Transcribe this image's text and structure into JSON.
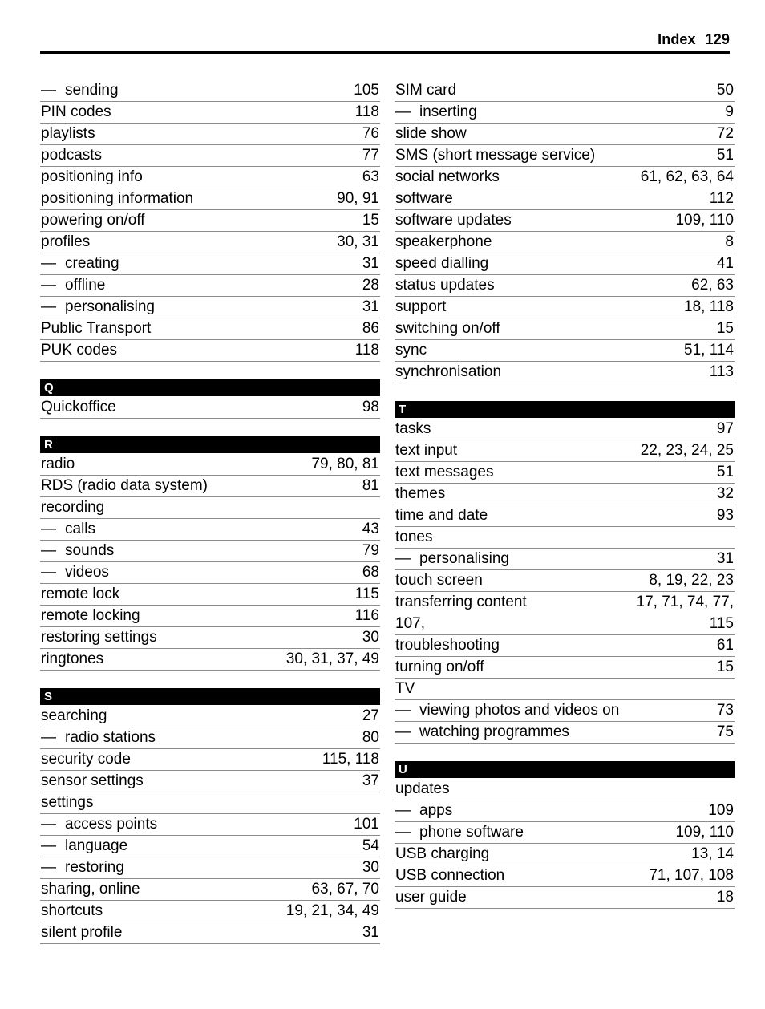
{
  "header": {
    "title": "Index",
    "page_number": "129"
  },
  "dash_glyph": "—",
  "columns": [
    {
      "id": "left-column",
      "sections": [
        {
          "letter": "",
          "has_bar": false,
          "entries": [
            {
              "term": "sending",
              "pages": "105",
              "sub": true
            },
            {
              "term": "PIN codes",
              "pages": "118",
              "sub": false
            },
            {
              "term": "playlists",
              "pages": "76",
              "sub": false
            },
            {
              "term": "podcasts",
              "pages": "77",
              "sub": false
            },
            {
              "term": "positioning info",
              "pages": "63",
              "sub": false
            },
            {
              "term": "positioning information",
              "pages": "90, 91",
              "sub": false
            },
            {
              "term": "powering on/off",
              "pages": "15",
              "sub": false
            },
            {
              "term": "profiles",
              "pages": "30, 31",
              "sub": false
            },
            {
              "term": "creating",
              "pages": "31",
              "sub": true
            },
            {
              "term": "offline",
              "pages": "28",
              "sub": true
            },
            {
              "term": "personalising",
              "pages": "31",
              "sub": true
            },
            {
              "term": "Public Transport",
              "pages": "86",
              "sub": false
            },
            {
              "term": "PUK codes",
              "pages": "118",
              "sub": false
            }
          ]
        },
        {
          "letter": "Q",
          "has_bar": true,
          "entries": [
            {
              "term": "Quickoffice",
              "pages": "98",
              "sub": false
            }
          ]
        },
        {
          "letter": "R",
          "has_bar": true,
          "entries": [
            {
              "term": "radio",
              "pages": "79, 80, 81",
              "sub": false
            },
            {
              "term": "RDS (radio data system)",
              "pages": "81",
              "sub": false
            },
            {
              "term": "recording",
              "pages": "",
              "sub": false
            },
            {
              "term": "calls",
              "pages": "43",
              "sub": true
            },
            {
              "term": "sounds",
              "pages": "79",
              "sub": true
            },
            {
              "term": "videos",
              "pages": "68",
              "sub": true
            },
            {
              "term": "remote lock",
              "pages": "115",
              "sub": false
            },
            {
              "term": "remote locking",
              "pages": "116",
              "sub": false
            },
            {
              "term": "restoring settings",
              "pages": "30",
              "sub": false
            },
            {
              "term": "ringtones",
              "pages": "30, 31, 37, 49",
              "sub": false
            }
          ]
        },
        {
          "letter": "S",
          "has_bar": true,
          "entries": [
            {
              "term": "searching",
              "pages": "27",
              "sub": false
            },
            {
              "term": "radio stations",
              "pages": "80",
              "sub": true
            },
            {
              "term": "security code",
              "pages": "115, 118",
              "sub": false
            },
            {
              "term": "sensor settings",
              "pages": "37",
              "sub": false
            },
            {
              "term": "settings",
              "pages": "",
              "sub": false
            },
            {
              "term": "access points",
              "pages": "101",
              "sub": true
            },
            {
              "term": "language",
              "pages": "54",
              "sub": true
            },
            {
              "term": "restoring",
              "pages": "30",
              "sub": true
            },
            {
              "term": "sharing, online",
              "pages": "63, 67, 70",
              "sub": false
            },
            {
              "term": "shortcuts",
              "pages": "19, 21, 34, 49",
              "sub": false
            },
            {
              "term": "silent profile",
              "pages": "31",
              "sub": false
            }
          ]
        }
      ]
    },
    {
      "id": "right-column",
      "sections": [
        {
          "letter": "",
          "has_bar": false,
          "entries": [
            {
              "term": "SIM card",
              "pages": "50",
              "sub": false
            },
            {
              "term": "inserting",
              "pages": "9",
              "sub": true
            },
            {
              "term": "slide show",
              "pages": "72",
              "sub": false
            },
            {
              "term": "SMS (short message service)",
              "pages": "51",
              "sub": false
            },
            {
              "term": "social networks",
              "pages": "61, 62, 63, 64",
              "sub": false
            },
            {
              "term": "software",
              "pages": "112",
              "sub": false
            },
            {
              "term": "software updates",
              "pages": "109, 110",
              "sub": false
            },
            {
              "term": "speakerphone",
              "pages": "8",
              "sub": false
            },
            {
              "term": "speed dialling",
              "pages": "41",
              "sub": false
            },
            {
              "term": "status updates",
              "pages": "62, 63",
              "sub": false
            },
            {
              "term": "support",
              "pages": "18, 118",
              "sub": false
            },
            {
              "term": "switching on/off",
              "pages": "15",
              "sub": false
            },
            {
              "term": "sync",
              "pages": "51, 114",
              "sub": false
            },
            {
              "term": "synchronisation",
              "pages": "113",
              "sub": false
            }
          ]
        },
        {
          "letter": "T",
          "has_bar": true,
          "entries": [
            {
              "term": "tasks",
              "pages": "97",
              "sub": false
            },
            {
              "term": "text input",
              "pages": "22, 23, 24, 25",
              "sub": false
            },
            {
              "term": "text messages",
              "pages": "51",
              "sub": false
            },
            {
              "term": "themes",
              "pages": "32",
              "sub": false
            },
            {
              "term": "time and date",
              "pages": "93",
              "sub": false
            },
            {
              "term": "tones",
              "pages": "",
              "sub": false
            },
            {
              "term": "personalising",
              "pages": "31",
              "sub": true
            },
            {
              "term": "touch screen",
              "pages": "8, 19, 22, 23",
              "sub": false
            },
            {
              "term": "transferring content",
              "pages": "17, 71, 74, 77,",
              "sub": false,
              "wrap": true,
              "term2": "107,",
              "pages2": "115"
            },
            {
              "term": "troubleshooting",
              "pages": "61",
              "sub": false
            },
            {
              "term": "turning on/off",
              "pages": "15",
              "sub": false
            },
            {
              "term": "TV",
              "pages": "",
              "sub": false
            },
            {
              "term": "viewing photos and videos on",
              "pages": "73",
              "sub": true
            },
            {
              "term": "watching programmes",
              "pages": "75",
              "sub": true
            }
          ]
        },
        {
          "letter": "U",
          "has_bar": true,
          "entries": [
            {
              "term": "updates",
              "pages": "",
              "sub": false
            },
            {
              "term": "apps",
              "pages": "109",
              "sub": true
            },
            {
              "term": "phone software",
              "pages": "109, 110",
              "sub": true
            },
            {
              "term": "USB charging",
              "pages": "13, 14",
              "sub": false
            },
            {
              "term": "USB connection",
              "pages": "71, 107, 108",
              "sub": false
            },
            {
              "term": "user guide",
              "pages": "18",
              "sub": false
            }
          ]
        }
      ]
    }
  ]
}
